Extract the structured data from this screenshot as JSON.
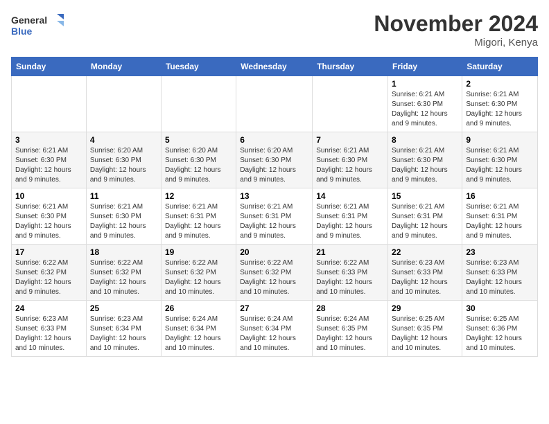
{
  "logo": {
    "line1": "General",
    "line2": "Blue"
  },
  "title": "November 2024",
  "location": "Migori, Kenya",
  "days_header": [
    "Sunday",
    "Monday",
    "Tuesday",
    "Wednesday",
    "Thursday",
    "Friday",
    "Saturday"
  ],
  "weeks": [
    [
      {
        "day": "",
        "info": ""
      },
      {
        "day": "",
        "info": ""
      },
      {
        "day": "",
        "info": ""
      },
      {
        "day": "",
        "info": ""
      },
      {
        "day": "",
        "info": ""
      },
      {
        "day": "1",
        "info": "Sunrise: 6:21 AM\nSunset: 6:30 PM\nDaylight: 12 hours and 9 minutes."
      },
      {
        "day": "2",
        "info": "Sunrise: 6:21 AM\nSunset: 6:30 PM\nDaylight: 12 hours and 9 minutes."
      }
    ],
    [
      {
        "day": "3",
        "info": "Sunrise: 6:21 AM\nSunset: 6:30 PM\nDaylight: 12 hours and 9 minutes."
      },
      {
        "day": "4",
        "info": "Sunrise: 6:20 AM\nSunset: 6:30 PM\nDaylight: 12 hours and 9 minutes."
      },
      {
        "day": "5",
        "info": "Sunrise: 6:20 AM\nSunset: 6:30 PM\nDaylight: 12 hours and 9 minutes."
      },
      {
        "day": "6",
        "info": "Sunrise: 6:20 AM\nSunset: 6:30 PM\nDaylight: 12 hours and 9 minutes."
      },
      {
        "day": "7",
        "info": "Sunrise: 6:21 AM\nSunset: 6:30 PM\nDaylight: 12 hours and 9 minutes."
      },
      {
        "day": "8",
        "info": "Sunrise: 6:21 AM\nSunset: 6:30 PM\nDaylight: 12 hours and 9 minutes."
      },
      {
        "day": "9",
        "info": "Sunrise: 6:21 AM\nSunset: 6:30 PM\nDaylight: 12 hours and 9 minutes."
      }
    ],
    [
      {
        "day": "10",
        "info": "Sunrise: 6:21 AM\nSunset: 6:30 PM\nDaylight: 12 hours and 9 minutes."
      },
      {
        "day": "11",
        "info": "Sunrise: 6:21 AM\nSunset: 6:30 PM\nDaylight: 12 hours and 9 minutes."
      },
      {
        "day": "12",
        "info": "Sunrise: 6:21 AM\nSunset: 6:31 PM\nDaylight: 12 hours and 9 minutes."
      },
      {
        "day": "13",
        "info": "Sunrise: 6:21 AM\nSunset: 6:31 PM\nDaylight: 12 hours and 9 minutes."
      },
      {
        "day": "14",
        "info": "Sunrise: 6:21 AM\nSunset: 6:31 PM\nDaylight: 12 hours and 9 minutes."
      },
      {
        "day": "15",
        "info": "Sunrise: 6:21 AM\nSunset: 6:31 PM\nDaylight: 12 hours and 9 minutes."
      },
      {
        "day": "16",
        "info": "Sunrise: 6:21 AM\nSunset: 6:31 PM\nDaylight: 12 hours and 9 minutes."
      }
    ],
    [
      {
        "day": "17",
        "info": "Sunrise: 6:22 AM\nSunset: 6:32 PM\nDaylight: 12 hours and 9 minutes."
      },
      {
        "day": "18",
        "info": "Sunrise: 6:22 AM\nSunset: 6:32 PM\nDaylight: 12 hours and 10 minutes."
      },
      {
        "day": "19",
        "info": "Sunrise: 6:22 AM\nSunset: 6:32 PM\nDaylight: 12 hours and 10 minutes."
      },
      {
        "day": "20",
        "info": "Sunrise: 6:22 AM\nSunset: 6:32 PM\nDaylight: 12 hours and 10 minutes."
      },
      {
        "day": "21",
        "info": "Sunrise: 6:22 AM\nSunset: 6:33 PM\nDaylight: 12 hours and 10 minutes."
      },
      {
        "day": "22",
        "info": "Sunrise: 6:23 AM\nSunset: 6:33 PM\nDaylight: 12 hours and 10 minutes."
      },
      {
        "day": "23",
        "info": "Sunrise: 6:23 AM\nSunset: 6:33 PM\nDaylight: 12 hours and 10 minutes."
      }
    ],
    [
      {
        "day": "24",
        "info": "Sunrise: 6:23 AM\nSunset: 6:33 PM\nDaylight: 12 hours and 10 minutes."
      },
      {
        "day": "25",
        "info": "Sunrise: 6:23 AM\nSunset: 6:34 PM\nDaylight: 12 hours and 10 minutes."
      },
      {
        "day": "26",
        "info": "Sunrise: 6:24 AM\nSunset: 6:34 PM\nDaylight: 12 hours and 10 minutes."
      },
      {
        "day": "27",
        "info": "Sunrise: 6:24 AM\nSunset: 6:34 PM\nDaylight: 12 hours and 10 minutes."
      },
      {
        "day": "28",
        "info": "Sunrise: 6:24 AM\nSunset: 6:35 PM\nDaylight: 12 hours and 10 minutes."
      },
      {
        "day": "29",
        "info": "Sunrise: 6:25 AM\nSunset: 6:35 PM\nDaylight: 12 hours and 10 minutes."
      },
      {
        "day": "30",
        "info": "Sunrise: 6:25 AM\nSunset: 6:36 PM\nDaylight: 12 hours and 10 minutes."
      }
    ]
  ]
}
